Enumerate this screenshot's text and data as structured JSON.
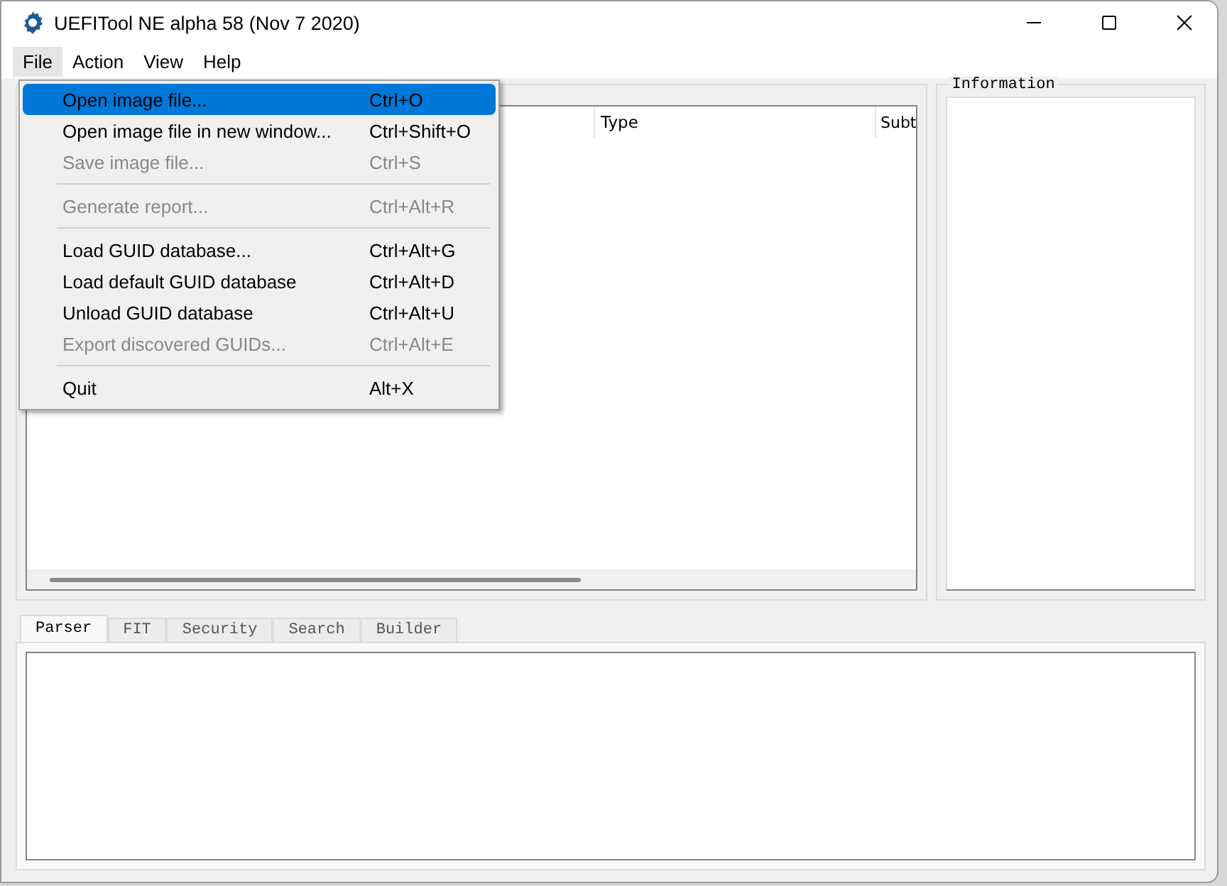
{
  "window": {
    "title": "UEFITool NE alpha 58 (Nov  7 2020)"
  },
  "menubar": [
    {
      "label": "File",
      "selected": true
    },
    {
      "label": "Action",
      "selected": false
    },
    {
      "label": "View",
      "selected": false
    },
    {
      "label": "Help",
      "selected": false
    }
  ],
  "file_menu": [
    {
      "kind": "item",
      "label": "Open image file...",
      "shortcut": "Ctrl+O",
      "disabled": false,
      "selected": true
    },
    {
      "kind": "item",
      "label": "Open image file in new window...",
      "shortcut": "Ctrl+Shift+O",
      "disabled": false,
      "selected": false
    },
    {
      "kind": "item",
      "label": "Save image file...",
      "shortcut": "Ctrl+S",
      "disabled": true,
      "selected": false
    },
    {
      "kind": "separator"
    },
    {
      "kind": "item",
      "label": "Generate report...",
      "shortcut": "Ctrl+Alt+R",
      "disabled": true,
      "selected": false
    },
    {
      "kind": "separator"
    },
    {
      "kind": "item",
      "label": "Load GUID database...",
      "shortcut": "Ctrl+Alt+G",
      "disabled": false,
      "selected": false
    },
    {
      "kind": "item",
      "label": "Load default GUID database",
      "shortcut": "Ctrl+Alt+D",
      "disabled": false,
      "selected": false
    },
    {
      "kind": "item",
      "label": "Unload GUID database",
      "shortcut": "Ctrl+Alt+U",
      "disabled": false,
      "selected": false
    },
    {
      "kind": "item",
      "label": "Export discovered GUIDs...",
      "shortcut": "Ctrl+Alt+E",
      "disabled": true,
      "selected": false
    },
    {
      "kind": "separator"
    },
    {
      "kind": "item",
      "label": "Quit",
      "shortcut": "Alt+X",
      "disabled": false,
      "selected": false
    }
  ],
  "structure": {
    "columns": [
      "",
      "Type",
      "Subt"
    ]
  },
  "information": {
    "title": "Information"
  },
  "tabs": [
    {
      "label": "Parser",
      "selected": true
    },
    {
      "label": "FIT",
      "selected": false
    },
    {
      "label": "Security",
      "selected": false
    },
    {
      "label": "Search",
      "selected": false
    },
    {
      "label": "Builder",
      "selected": false
    }
  ]
}
